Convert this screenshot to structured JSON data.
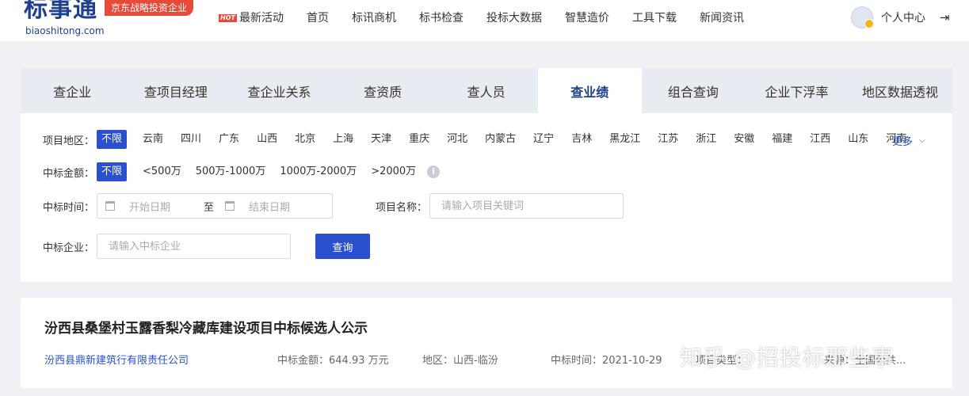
{
  "header": {
    "logo_text": "标事通",
    "logo_domain": "biaoshitong.com",
    "logo_tag": "京东战略投资企业",
    "nav": [
      {
        "label": "最新活动",
        "badge": "HOT"
      },
      {
        "label": "首页"
      },
      {
        "label": "标讯商机"
      },
      {
        "label": "标书检查"
      },
      {
        "label": "投标大数据"
      },
      {
        "label": "智慧造价"
      },
      {
        "label": "工具下载"
      },
      {
        "label": "新闻资讯"
      }
    ],
    "user_center": "个人中心"
  },
  "tabs": [
    "查企业",
    "查项目经理",
    "查企业关系",
    "查资质",
    "查人员",
    "查业绩",
    "组合查询",
    "企业下浮率",
    "地区数据透视"
  ],
  "active_tab": "查业绩",
  "filters": {
    "region": {
      "label": "项目地区：",
      "options": [
        "不限",
        "云南",
        "四川",
        "广东",
        "山西",
        "北京",
        "上海",
        "天津",
        "重庆",
        "河北",
        "内蒙古",
        "辽宁",
        "吉林",
        "黑龙江",
        "江苏",
        "浙江",
        "安徽",
        "福建",
        "江西",
        "山东",
        "河南"
      ],
      "selected": "不限",
      "more_label": "更多"
    },
    "amount": {
      "label": "中标金额：",
      "options": [
        "不限",
        "<500万",
        "500万-1000万",
        "1000万-2000万",
        ">2000万"
      ],
      "selected": "不限"
    },
    "date": {
      "label": "中标时间：",
      "start_placeholder": "开始日期",
      "separator": "至",
      "end_placeholder": "结束日期"
    },
    "project_name": {
      "label": "项目名称：",
      "placeholder": "请输入项目关键词"
    },
    "company": {
      "label": "中标企业：",
      "placeholder": "请输入中标企业"
    },
    "query_button": "查询"
  },
  "result": {
    "title": "汾西县桑堡村玉露香梨冷藏库建设项目中标候选人公示",
    "company": "汾西县鼎新建筑行有限责任公司",
    "amount": "中标金额：644.93 万元",
    "region": "地区：山西-临汾",
    "date": "中标时间：2021-10-29",
    "type_partial": "项目类型：",
    "source_partial": "来源：全国公共..."
  },
  "watermark": "知乎 @招投标那些事",
  "colors": {
    "primary": "#2a4fcf",
    "brand": "#1f3f8f",
    "tag_red": "#e84a3a"
  }
}
